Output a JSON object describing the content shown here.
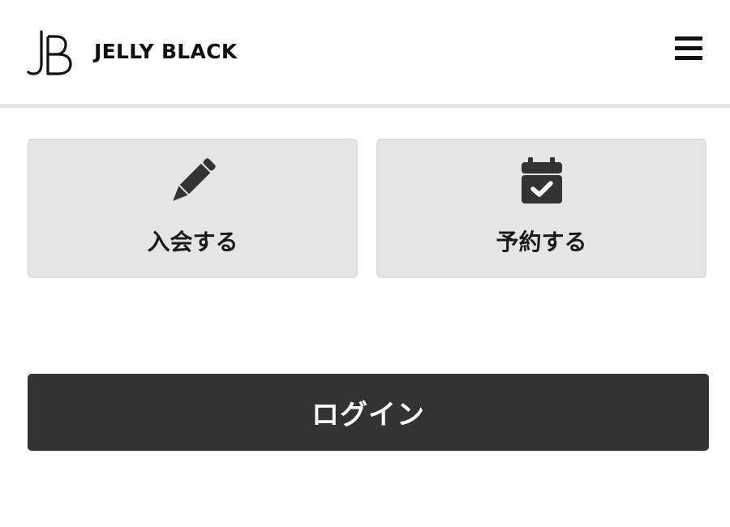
{
  "header": {
    "logo_icon": "jb-monogram-logo",
    "brand_name": "JELLY BLACK",
    "menu_icon": "hamburger-menu-icon"
  },
  "actions": [
    {
      "label": "入会する",
      "icon": "pencil-icon"
    },
    {
      "label": "予約する",
      "icon": "calendar-check-icon"
    }
  ],
  "login": {
    "label": "ログイン"
  },
  "colors": {
    "card_background": "#e5e5e5",
    "login_background": "#333333",
    "text": "#111111",
    "divider": "#e6e6e6"
  }
}
